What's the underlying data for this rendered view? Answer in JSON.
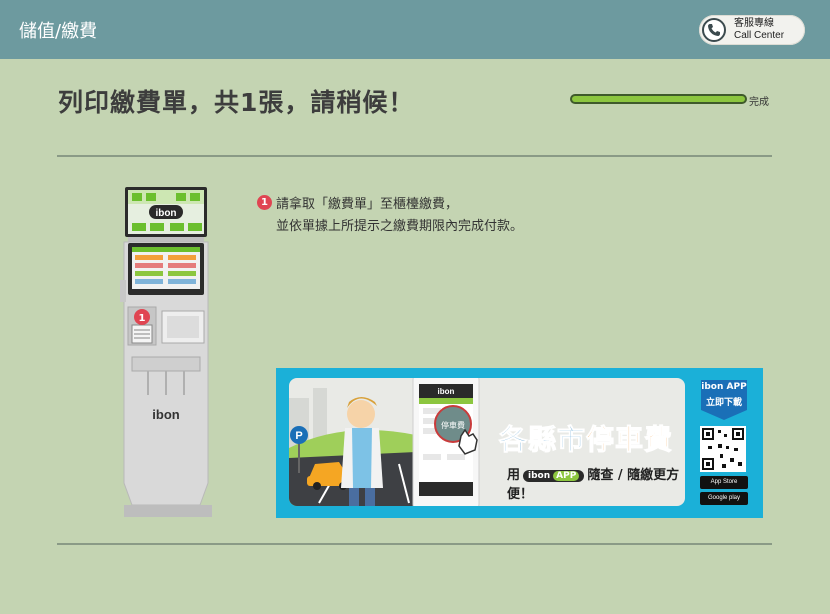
{
  "header": {
    "title": "儲值/繳費",
    "call_center": {
      "line1": "客服專線",
      "line2": "Call Center",
      "icon": "phone-icon"
    }
  },
  "main": {
    "title": "列印繳費單，共1張，請稍候！",
    "progress": {
      "label": "完成",
      "fraction": 1.0
    },
    "kiosk": {
      "logo": "ibon",
      "step_marker": "1"
    },
    "instruction": {
      "step_number": "1",
      "line1": "請拿取「繳費單」至櫃檯繳費，",
      "line2": "並依單據上所提示之繳費期限內完成付款。"
    },
    "banner": {
      "phone_logo": "ibon",
      "phone_button": "停車費",
      "headline_part1": "各縣市",
      "headline_part2": "停車費",
      "sub_prefix": "用",
      "sub_pill_logo": "ibon",
      "sub_pill_app": "APP",
      "sub_suffix": "隨查 / 隨繳更方便！",
      "app_badge_line1": "ibon APP",
      "app_badge_line2": "立即下載",
      "app_store": "App Store",
      "google_play": "Google play",
      "parking_sign": "P"
    }
  },
  "colors": {
    "background": "#c4d4b2",
    "header": "#6d9a9f",
    "progress_fill": "#8cc63f",
    "badge_red": "#e04552",
    "banner_blue": "#1bb0d8",
    "headline_blue": "#1a7bc2",
    "headline_orange": "#f28a1c"
  }
}
